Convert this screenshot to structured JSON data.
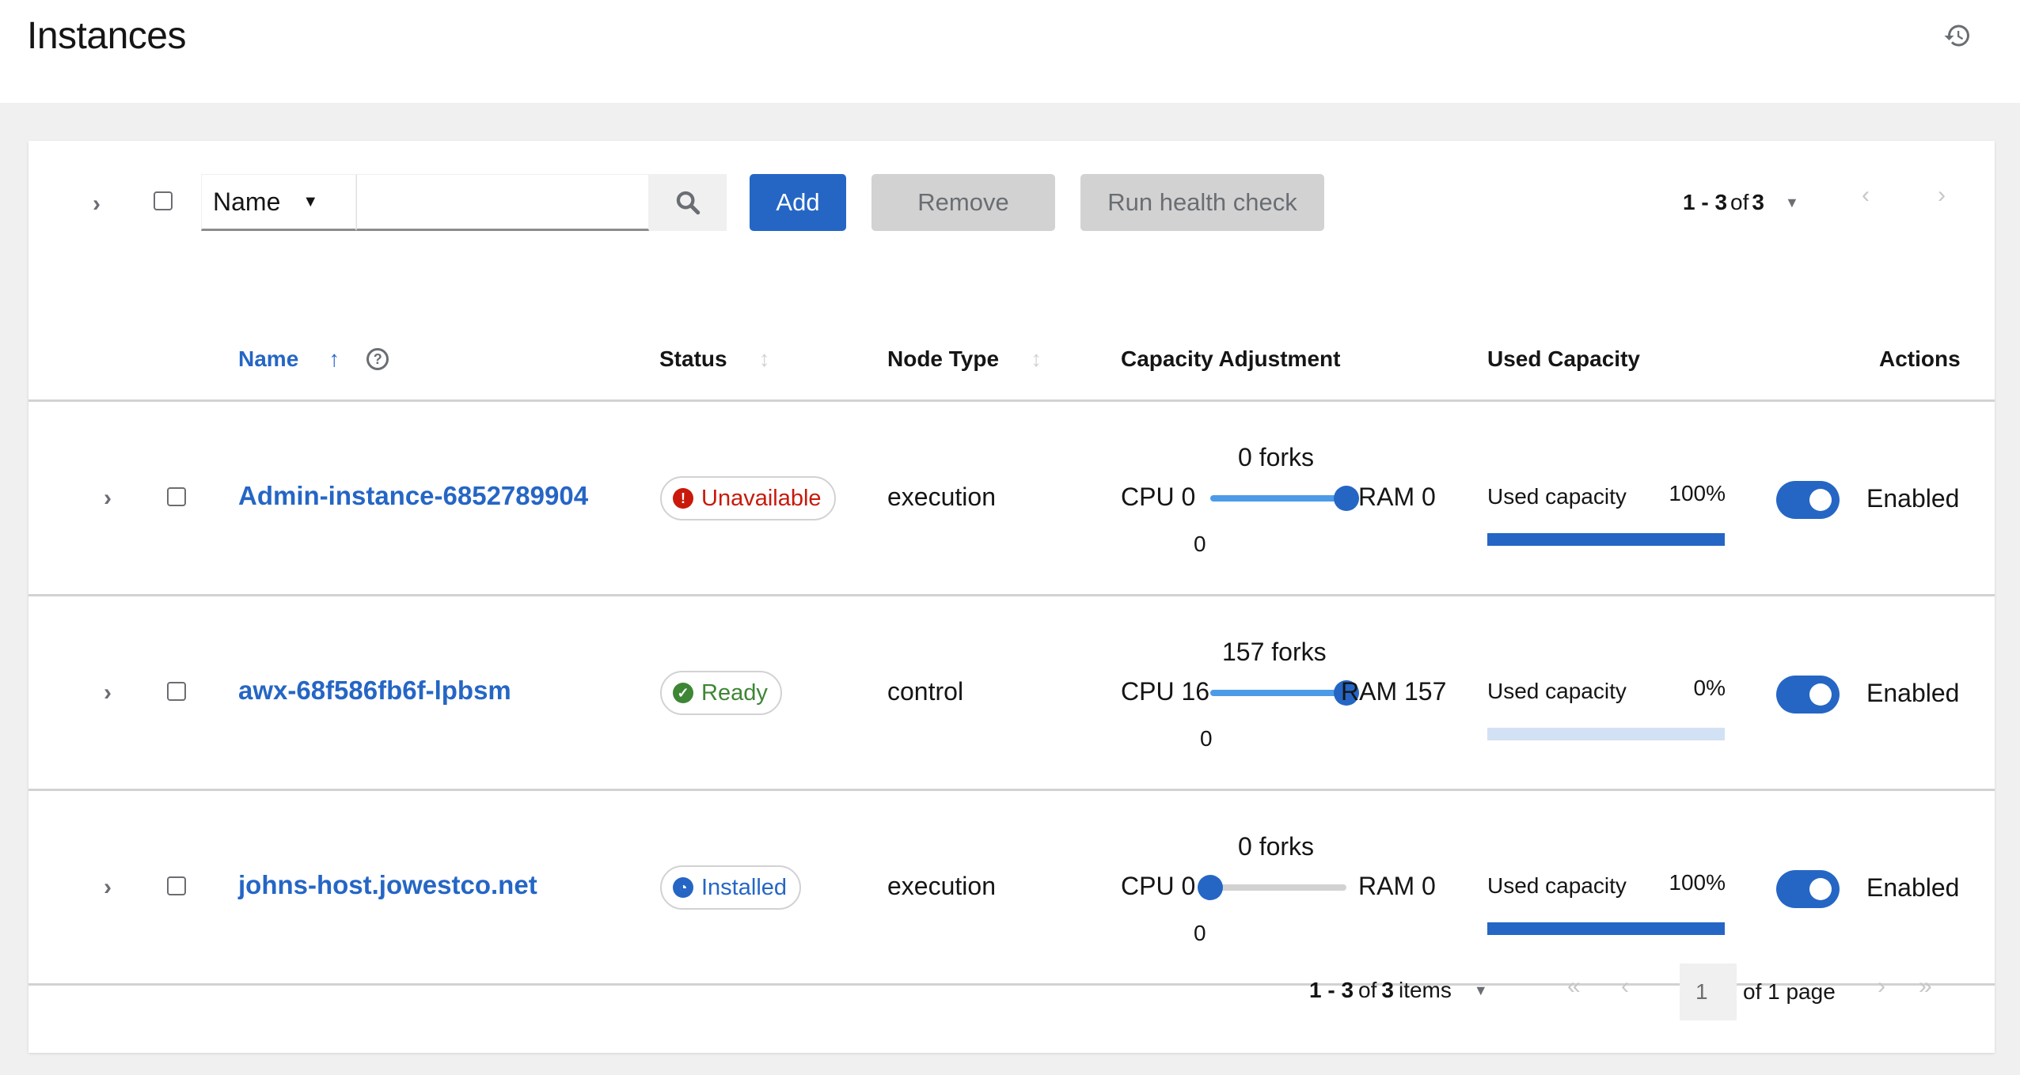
{
  "header": {
    "title": "Instances",
    "history_icon": "history-icon"
  },
  "toolbar": {
    "filter_field": "Name",
    "search_placeholder": "",
    "search_value": "",
    "add_label": "Add",
    "remove_label": "Remove",
    "health_check_label": "Run health check",
    "pagination": {
      "range": "1 - 3",
      "of_label": "of",
      "total": "3"
    }
  },
  "columns": {
    "name": "Name",
    "status": "Status",
    "node_type": "Node Type",
    "capacity_adjustment": "Capacity Adjustment",
    "used_capacity": "Used Capacity",
    "actions": "Actions"
  },
  "rows": [
    {
      "name": "Admin-instance-6852789904",
      "status": "Unavailable",
      "status_color": "#c9190b",
      "status_icon": "exclamation-circle-icon",
      "node_type": "execution",
      "forks": "0 forks",
      "cpu": "CPU 0",
      "ram": "RAM 0",
      "slider_min_label": "0",
      "slider_position": 1.0,
      "used_capacity_label": "Used capacity",
      "used_capacity_pct": "100%",
      "used_capacity_value": 100,
      "enabled": true,
      "enabled_label": "Enabled"
    },
    {
      "name": "awx-68f586fb6f-lpbsm",
      "status": "Ready",
      "status_color": "#3e8635",
      "status_icon": "check-circle-icon",
      "node_type": "control",
      "forks": "157 forks",
      "cpu": "CPU 16",
      "ram": "RAM 157",
      "slider_min_label": "0",
      "slider_position": 1.0,
      "used_capacity_label": "Used capacity",
      "used_capacity_pct": "0%",
      "used_capacity_value": 0,
      "enabled": true,
      "enabled_label": "Enabled"
    },
    {
      "name": "johns-host.jowestco.net",
      "status": "Installed",
      "status_color": "#2566c5",
      "status_icon": "clock-icon",
      "node_type": "execution",
      "forks": "0 forks",
      "cpu": "CPU 0",
      "ram": "RAM 0",
      "slider_min_label": "0",
      "slider_position": 0.0,
      "used_capacity_label": "Used capacity",
      "used_capacity_pct": "100%",
      "used_capacity_value": 100,
      "enabled": true,
      "enabled_label": "Enabled"
    }
  ],
  "footer": {
    "range": "1 - 3",
    "of_label": "of",
    "total": "3",
    "items_label": "items",
    "current_page": "1",
    "of_pages": "of 1 page"
  }
}
